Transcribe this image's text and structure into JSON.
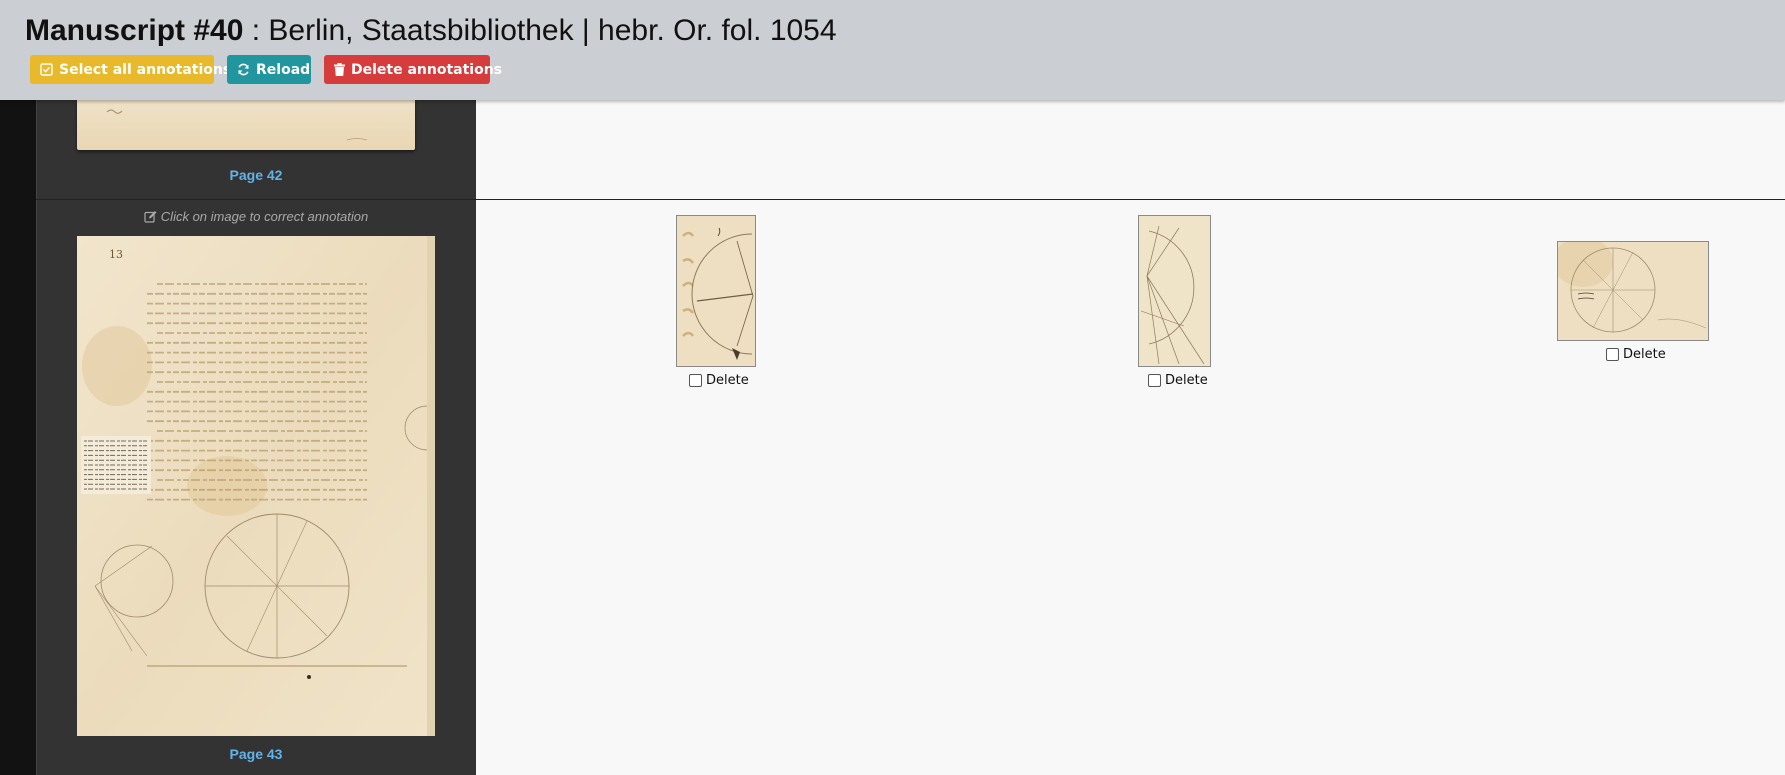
{
  "header": {
    "manuscript_label": "Manuscript #40",
    "manuscript_subtitle": " : Berlin, Staatsbibliothek | hebr. Or. fol. 1054",
    "buttons": {
      "select_all": "Select all annotations",
      "reload": "Reload",
      "delete_annotations": "Delete annotations"
    }
  },
  "pages": [
    {
      "label": "Page 42"
    },
    {
      "label": "Page 43",
      "hint": "Click on image to correct annotation"
    }
  ],
  "annotations": [
    {
      "delete_label": "Delete"
    },
    {
      "delete_label": "Delete"
    },
    {
      "delete_label": "Delete"
    }
  ],
  "colors": {
    "header_bg": "#cbced3",
    "select_all_button": "#e7b92b",
    "reload_button": "#21969f",
    "delete_button": "#d73c3c",
    "page_label": "#62b3e8",
    "panel_bg": "#333333"
  },
  "icons": {
    "select_all": "check-square-icon",
    "reload": "refresh-icon",
    "delete": "trash-icon",
    "hint": "edit-icon"
  }
}
